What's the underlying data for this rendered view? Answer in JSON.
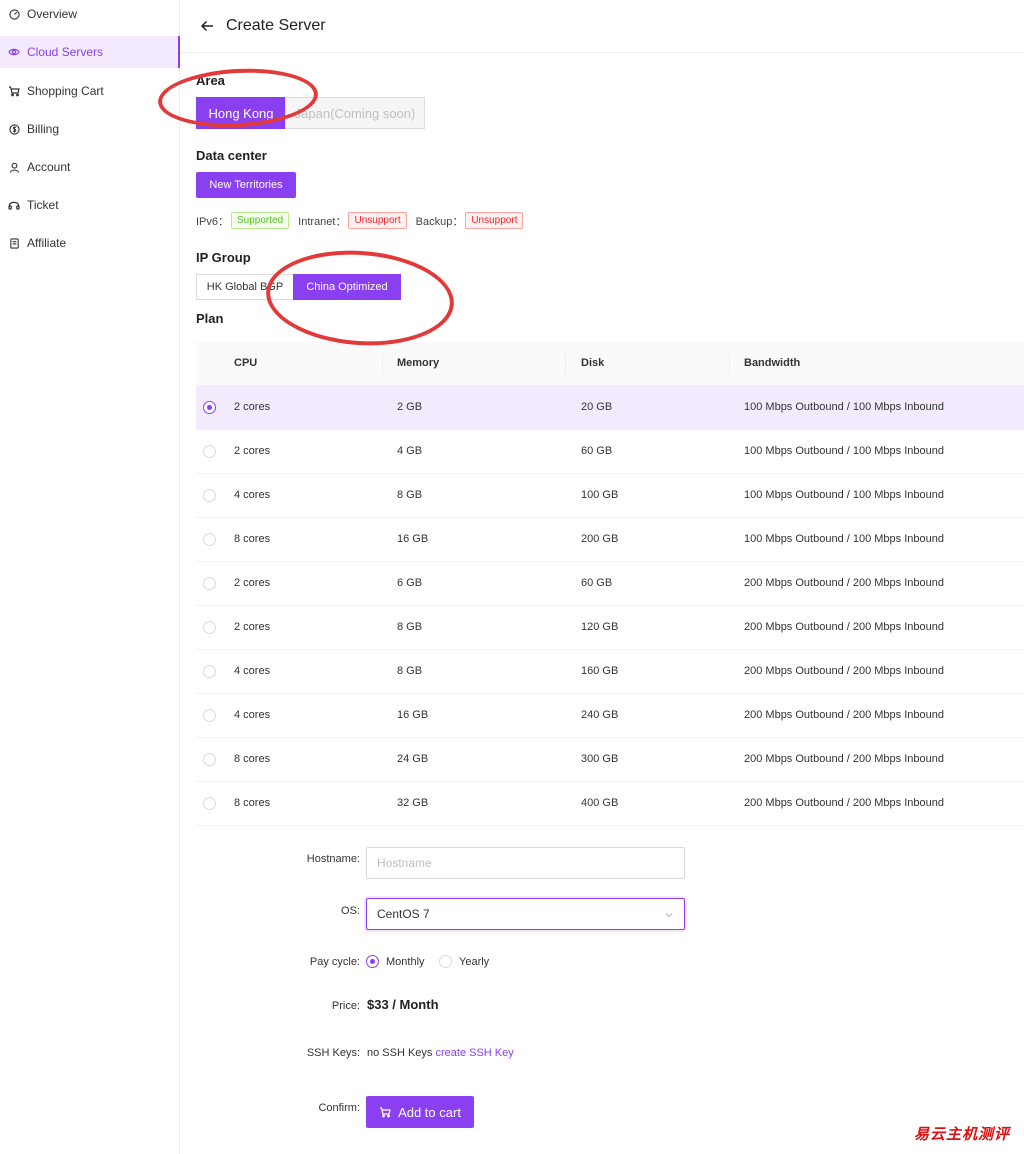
{
  "sidebar": {
    "items": [
      {
        "label": "Overview",
        "icon": "gauge-icon",
        "active": false
      },
      {
        "label": "Cloud Servers",
        "icon": "eye-icon",
        "active": true
      },
      {
        "label": "Shopping Cart",
        "icon": "cart-icon",
        "active": false
      },
      {
        "label": "Billing",
        "icon": "dollar-icon",
        "active": false
      },
      {
        "label": "Account",
        "icon": "user-icon",
        "active": false
      },
      {
        "label": "Ticket",
        "icon": "headset-icon",
        "active": false
      },
      {
        "label": "Affiliate",
        "icon": "book-icon",
        "active": false
      }
    ]
  },
  "header": {
    "title": "Create Server"
  },
  "area": {
    "title": "Area",
    "options": [
      {
        "label": "Hong Kong",
        "state": "selected"
      },
      {
        "label": "Japan(Coming soon)",
        "state": "disabled"
      }
    ]
  },
  "datacenter": {
    "title": "Data center",
    "option": "New Territories",
    "features": [
      {
        "label": "IPv6：",
        "tag": "Supported",
        "status": "ok"
      },
      {
        "label": "Intranet：",
        "tag": "Unsupport",
        "status": "no"
      },
      {
        "label": "Backup：",
        "tag": "Unsupport",
        "status": "no"
      }
    ]
  },
  "ip_group": {
    "title": "IP Group",
    "options": [
      {
        "label": "HK Global BGP",
        "state": "normal"
      },
      {
        "label": "China Optimized",
        "state": "selected"
      }
    ]
  },
  "plan": {
    "title": "Plan",
    "columns": [
      "CPU",
      "Memory",
      "Disk",
      "Bandwidth"
    ],
    "rows": [
      {
        "cpu": "2 cores",
        "memory": "2 GB",
        "disk": "20 GB",
        "bandwidth": "100 Mbps Outbound / 100 Mbps Inbound",
        "selected": true
      },
      {
        "cpu": "2 cores",
        "memory": "4 GB",
        "disk": "60 GB",
        "bandwidth": "100 Mbps Outbound / 100 Mbps Inbound",
        "selected": false
      },
      {
        "cpu": "4 cores",
        "memory": "8 GB",
        "disk": "100 GB",
        "bandwidth": "100 Mbps Outbound / 100 Mbps Inbound",
        "selected": false
      },
      {
        "cpu": "8 cores",
        "memory": "16 GB",
        "disk": "200 GB",
        "bandwidth": "100 Mbps Outbound / 100 Mbps Inbound",
        "selected": false
      },
      {
        "cpu": "2 cores",
        "memory": "6 GB",
        "disk": "60 GB",
        "bandwidth": "200 Mbps Outbound / 200 Mbps Inbound",
        "selected": false
      },
      {
        "cpu": "2 cores",
        "memory": "8 GB",
        "disk": "120 GB",
        "bandwidth": "200 Mbps Outbound / 200 Mbps Inbound",
        "selected": false
      },
      {
        "cpu": "4 cores",
        "memory": "8 GB",
        "disk": "160 GB",
        "bandwidth": "200 Mbps Outbound / 200 Mbps Inbound",
        "selected": false
      },
      {
        "cpu": "4 cores",
        "memory": "16 GB",
        "disk": "240 GB",
        "bandwidth": "200 Mbps Outbound / 200 Mbps Inbound",
        "selected": false
      },
      {
        "cpu": "8 cores",
        "memory": "24 GB",
        "disk": "300 GB",
        "bandwidth": "200 Mbps Outbound / 200 Mbps Inbound",
        "selected": false
      },
      {
        "cpu": "8 cores",
        "memory": "32 GB",
        "disk": "400 GB",
        "bandwidth": "200 Mbps Outbound / 200 Mbps Inbound",
        "selected": false
      }
    ]
  },
  "form": {
    "hostname_label": "Hostname:",
    "hostname_value": "",
    "hostname_placeholder": "Hostname",
    "os_label": "OS:",
    "os_value": "CentOS 7",
    "pay_cycle_label": "Pay cycle:",
    "pay_cycle_options": [
      {
        "label": "Monthly",
        "selected": true
      },
      {
        "label": "Yearly",
        "selected": false
      }
    ],
    "price_label": "Price:",
    "price_value": "$33 / Month",
    "ssh_label": "SSH Keys:",
    "ssh_none": "no SSH Keys",
    "ssh_link": "create SSH Key",
    "confirm_label": "Confirm:",
    "add_to_cart": "Add to cart"
  },
  "watermark": "易云主机测评",
  "colors": {
    "accent": "#8a3ff0",
    "annotation": "#e23a3a"
  }
}
